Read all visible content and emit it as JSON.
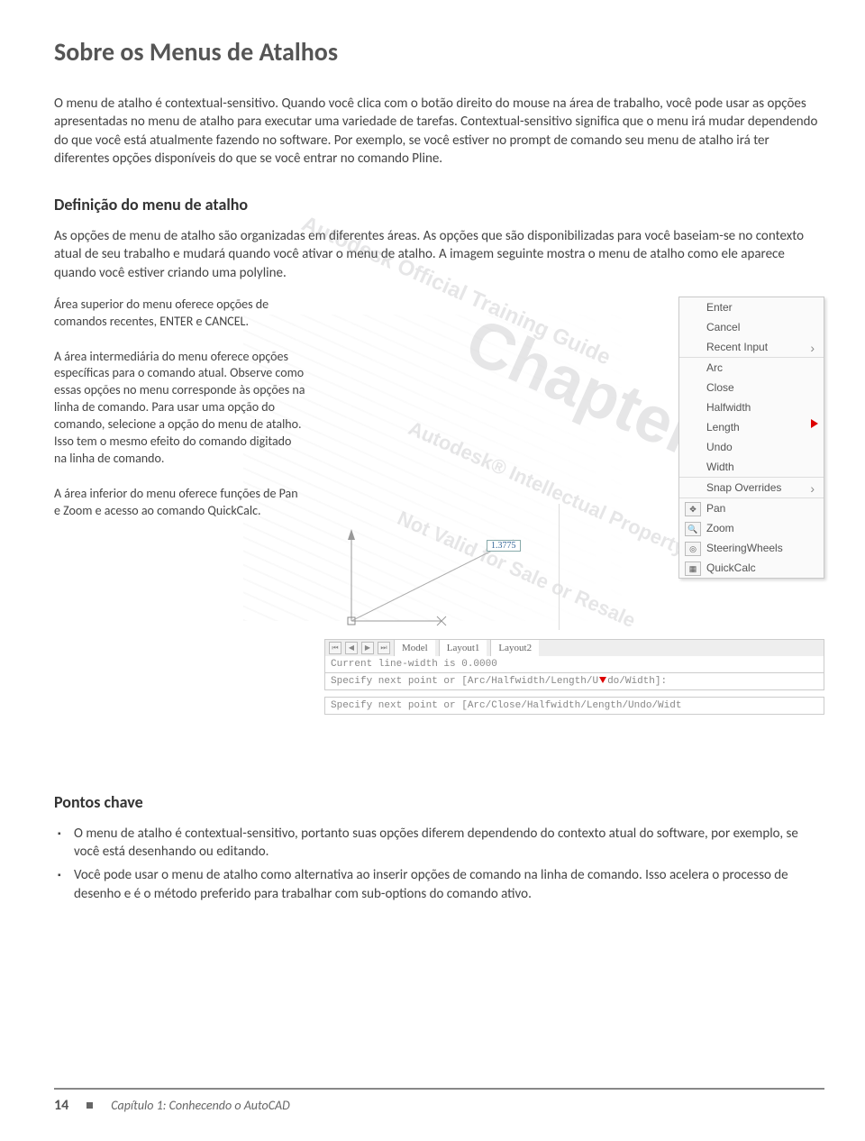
{
  "page": {
    "title": "Sobre os Menus de Atalhos",
    "intro": "O menu de atalho é contextual-sensitivo. Quando você clica com o botão direito do mouse na área de trabalho, você pode usar as opções apresentadas no menu de atalho para executar uma variedade de tarefas. Contextual-sensitivo significa que o menu irá mudar dependendo do que você está atualmente fazendo no software. Por exemplo, se você estiver no prompt de comando seu menu de atalho irá ter diferentes opções disponíveis do que se você entrar no comando Pline.",
    "section1_head": "Definição do menu de atalho",
    "section1_para": "As opções de menu de atalho são organizadas em diferentes áreas. As opções que são disponibilizadas para você baseiam-se no contexto atual de seu trabalho e mudará quando você ativar o menu de atalho. A imagem seguinte mostra o menu de atalho como ele aparece quando você estiver criando uma polyline.",
    "left_p1": "Área superior do menu oferece opções de comandos recentes, ENTER e CANCEL.",
    "left_p2": "A área intermediária do menu oferece opções específicas para o comando atual. Observe como essas opções no menu corresponde às opções na linha de comando. Para usar uma opção do comando, selecione a opção do menu de atalho. Isso tem o mesmo efeito do comando digitado na linha de comando.",
    "left_p3": "A área inferior do menu oferece funções de Pan e Zoom e acesso ao comando QuickCalc.",
    "section2_head": "Pontos chave",
    "bullet1": "O menu de atalho é contextual-sensitivo, portanto suas opções diferem dependendo do contexto atual do software, por exemplo, se você está desenhando ou editando.",
    "bullet2": " Você pode usar o menu de atalho como alternativa ao inserir opções de comando na linha de comando. Isso acelera o processo de desenho e é o método preferido para trabalhar com sub-options do comando ativo."
  },
  "watermark": {
    "chapter": "Chapter",
    "guide": "Autodesk Official Training Guide",
    "ip": "Autodesk® Intellectual Property",
    "resale": "Not Valid for Sale or Resale"
  },
  "menu": {
    "sect1": {
      "enter": "Enter",
      "cancel": "Cancel",
      "recent": "Recent Input"
    },
    "sect2": {
      "arc": "Arc",
      "close": "Close",
      "halfwidth": "Halfwidth",
      "length": "Length",
      "undo": "Undo",
      "width": "Width"
    },
    "sect3": {
      "snap": "Snap Overrides"
    },
    "sect4": {
      "pan": "Pan",
      "zoom": "Zoom",
      "steering": "SteeringWheels",
      "quickcalc": "QuickCalc"
    }
  },
  "drawing": {
    "badge": "1.3775"
  },
  "tabs": {
    "model": "Model",
    "l1": "Layout1",
    "l2": "Layout2"
  },
  "cmd": {
    "l1": "Current line-width is 0.0000",
    "l2a": "Specify next point or [Arc/Halfwidth/Length/U",
    "l2b": "do/Width]:",
    "l3": "Specify next point or [Arc/Close/Halfwidth/Length/Undo/Widt"
  },
  "footer": {
    "page": "14",
    "chapter": "Capítulo 1: Conhecendo o AutoCAD"
  }
}
